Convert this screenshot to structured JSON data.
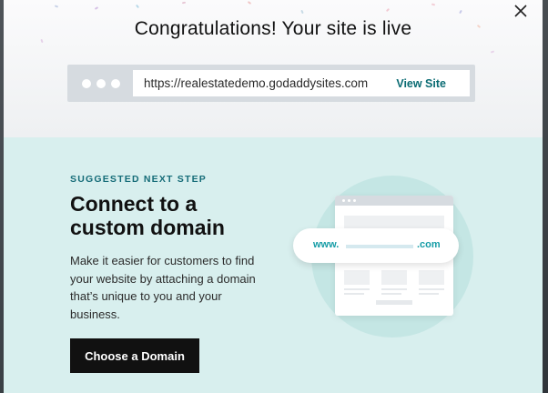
{
  "modal": {
    "title": "Congratulations! Your site is live",
    "url_bar": {
      "url": "https://realestatedemo.godaddysites.com",
      "view_site_label": "View Site"
    },
    "suggestion": {
      "eyebrow": "SUGGESTED NEXT STEP",
      "heading_line1": "Connect to a",
      "heading_line2": "custom domain",
      "description": "Make it easier for customers to find your website by attaching a domain that’s unique to you and your business.",
      "cta_label": "Choose a Domain"
    },
    "illustration": {
      "prefix": "www.",
      "suffix": ".com"
    }
  },
  "icons": {
    "close": "close-icon",
    "dots": "browser-dots-icon"
  },
  "colors": {
    "accent_teal": "#0a6b73",
    "eyebrow_teal": "#156c78",
    "section_bg": "#d8efee",
    "cta_bg": "#111111"
  }
}
